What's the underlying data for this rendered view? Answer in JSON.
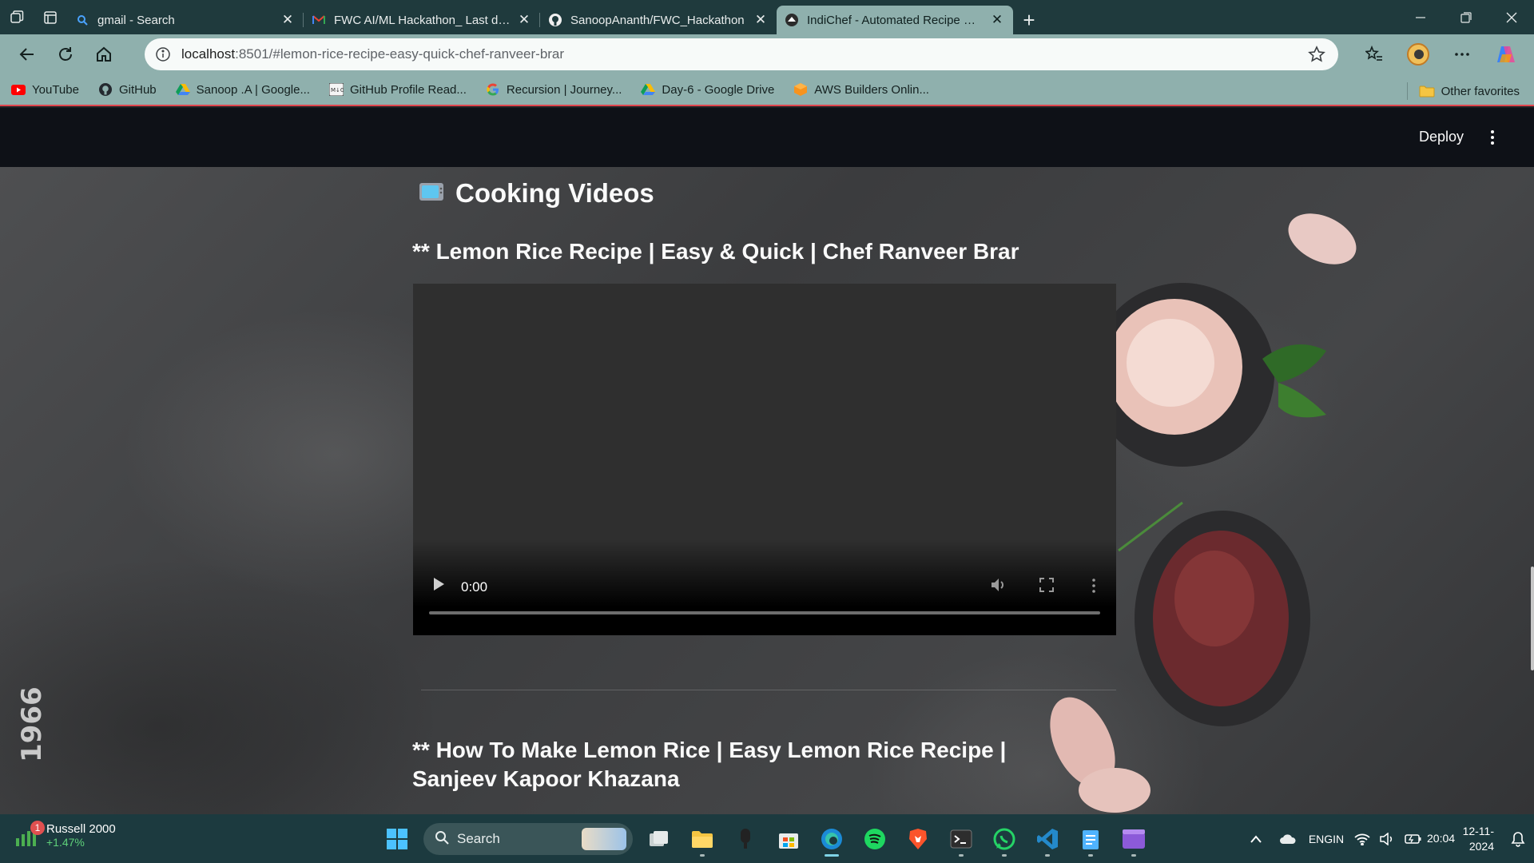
{
  "browser": {
    "tabs": [
      {
        "title": "gmail - Search",
        "icon": "search-icon"
      },
      {
        "title": "FWC AI/ML Hackathon_ Last date",
        "icon": "gmail-icon"
      },
      {
        "title": "SanoopAnanth/FWC_Hackathon",
        "icon": "github-icon"
      },
      {
        "title": "IndiChef - Automated Recipe Gen",
        "icon": "streamlit-icon",
        "active": true
      }
    ],
    "url_host": "localhost",
    "url_rest": ":8501/#lemon-rice-recipe-easy-quick-chef-ranveer-brar",
    "bookmarks": [
      {
        "label": "YouTube",
        "icon": "youtube-icon"
      },
      {
        "label": "GitHub",
        "icon": "github-icon"
      },
      {
        "label": "Sanoop .A | Google...",
        "icon": "google-drive-icon"
      },
      {
        "label": "GitHub Profile Read...",
        "icon": "readme-icon"
      },
      {
        "label": "Recursion | Journey...",
        "icon": "google-icon"
      },
      {
        "label": "Day-6 - Google Drive",
        "icon": "google-drive-icon"
      },
      {
        "label": "AWS Builders Onlin...",
        "icon": "aws-icon"
      }
    ],
    "other_favorites": "Other favorites"
  },
  "app": {
    "deploy_label": "Deploy",
    "section_title": "Cooking Videos",
    "videos": [
      {
        "title": "** Lemon Rice Recipe | Easy & Quick | Chef Ranveer Brar",
        "time": "0:00"
      },
      {
        "title": "** How To Make Lemon Rice | Easy Lemon Rice Recipe | Sanjeev Kapoor Khazana"
      }
    ],
    "side_number": "1966"
  },
  "taskbar": {
    "widget_name": "Russell 2000",
    "widget_change": "+1.47%",
    "widget_badge": "1",
    "search_label": "Search",
    "language": "ENG",
    "region": "IN",
    "time": "20:04",
    "date": "12-11-2024"
  },
  "colors": {
    "tab_strip": "#1f3a3d",
    "toolbar": "#8fb0ad",
    "app_header": "#0e1117",
    "taskbar": "#1c3a3f"
  }
}
